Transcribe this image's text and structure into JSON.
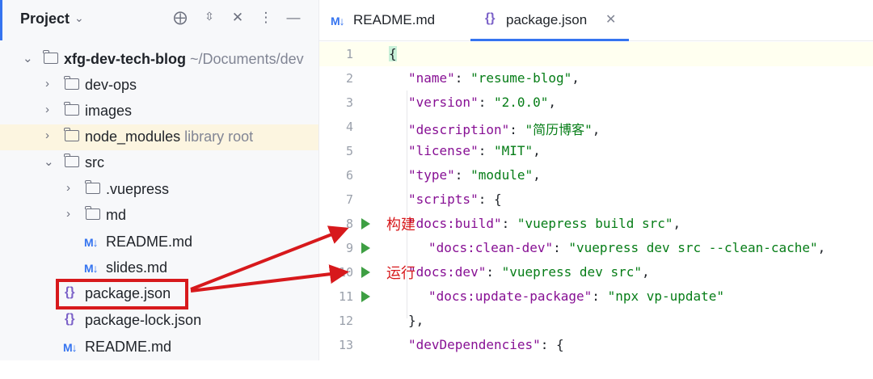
{
  "project_panel": {
    "title": "Project",
    "tree": [
      {
        "label": "xfg-dev-tech-blog",
        "hint": "~/Documents/dev",
        "type": "folder",
        "expanded": true
      },
      {
        "label": "dev-ops",
        "type": "folder"
      },
      {
        "label": "images",
        "type": "folder"
      },
      {
        "label": "node_modules",
        "hint": "library root",
        "type": "folder"
      },
      {
        "label": "src",
        "type": "folder",
        "expanded": true
      },
      {
        "label": ".vuepress",
        "type": "folder"
      },
      {
        "label": "md",
        "type": "folder"
      },
      {
        "label": "README.md",
        "type": "markdown"
      },
      {
        "label": "slides.md",
        "type": "markdown"
      },
      {
        "label": "package.json",
        "type": "json"
      },
      {
        "label": "package-lock.json",
        "type": "json"
      },
      {
        "label": "README.md",
        "type": "markdown"
      }
    ]
  },
  "tabs": [
    {
      "label": "README.md",
      "icon": "M↓"
    },
    {
      "label": "package.json",
      "icon": "{}"
    }
  ],
  "annotations": {
    "build": "构建",
    "run": "运行"
  },
  "code": {
    "line_numbers": [
      "1",
      "2",
      "3",
      "4",
      "5",
      "6",
      "7",
      "8",
      "9",
      "10",
      "11",
      "12",
      "13"
    ],
    "l1": "{",
    "l2_key": "\"name\"",
    "l2_val": "\"resume-blog\"",
    "l3_key": "\"version\"",
    "l3_val": "\"2.0.0\"",
    "l4_key": "\"description\"",
    "l4_val": "\"简历博客\"",
    "l5_key": "\"license\"",
    "l5_val": "\"MIT\"",
    "l6_key": "\"type\"",
    "l6_val": "\"module\"",
    "l7_key": "\"scripts\"",
    "l8_key": "\"docs:build\"",
    "l8_val": "\"vuepress build src\"",
    "l9_key": "\"docs:clean-dev\"",
    "l9_val": "\"vuepress dev src --clean-cache\"",
    "l10_key": "\"docs:dev\"",
    "l10_val": "\"vuepress dev src\"",
    "l11_key": "\"docs:update-package\"",
    "l11_val": "\"npx vp-update\"",
    "l12": "},",
    "l13_key": "\"devDependencies\""
  },
  "colors": {
    "accent": "#3574f0",
    "annotation_red": "#d7191c",
    "run_green": "#3e9f43"
  }
}
